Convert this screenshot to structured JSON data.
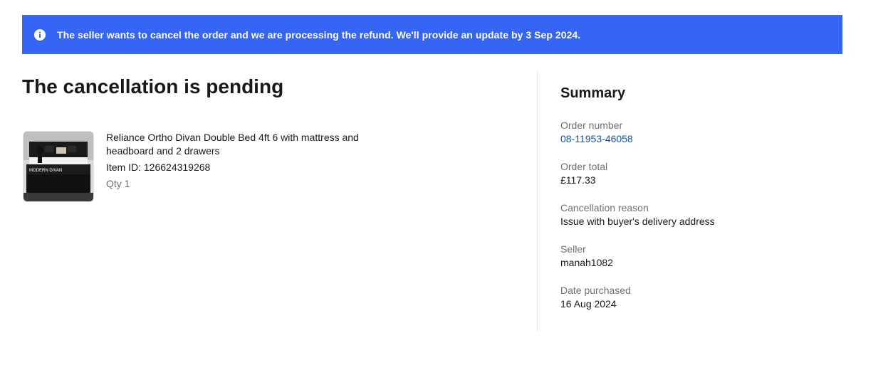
{
  "banner": {
    "message": "The seller wants to cancel the order and we are processing the refund. We'll provide an update by 3 Sep 2024."
  },
  "page_title": "The cancellation is pending",
  "item": {
    "title": "Reliance Ortho Divan Double Bed 4ft 6 with mattress and headboard and 2 drawers",
    "item_id": "Item ID: 126624319268",
    "qty": "Qty 1",
    "thumbnail_label": "MODERN DIVAN"
  },
  "summary": {
    "heading": "Summary",
    "fields": [
      {
        "label": "Order number",
        "value": "08-11953-46058"
      },
      {
        "label": "Order total",
        "value": "£117.33"
      },
      {
        "label": "Cancellation reason",
        "value": "Issue with buyer's delivery address"
      },
      {
        "label": "Seller",
        "value": "manah1082"
      },
      {
        "label": "Date purchased",
        "value": "16 Aug 2024"
      }
    ]
  },
  "colors": {
    "banner_bg": "#3665f3",
    "link": "#0654ba",
    "muted_text": "#707070"
  }
}
